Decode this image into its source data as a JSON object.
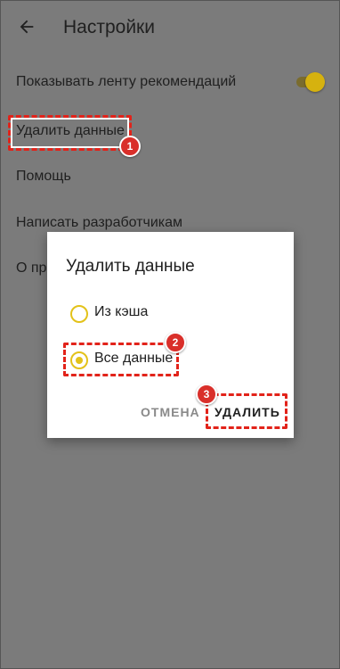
{
  "header": {
    "title": "Настройки",
    "back_icon": "arrow-back-icon"
  },
  "settings": {
    "items": [
      {
        "label": "Показывать ленту рекомендаций"
      },
      {
        "label": "Удалить данные"
      },
      {
        "label": "Помощь"
      },
      {
        "label": "Написать разработчикам"
      },
      {
        "label": "О про"
      }
    ],
    "toggle_on": true
  },
  "dialog": {
    "title": "Удалить данные",
    "options": [
      {
        "label": "Из кэша",
        "selected": false
      },
      {
        "label": "Все данные",
        "selected": true
      }
    ],
    "cancel_label": "ОТМЕНА",
    "confirm_label": "УДАЛИТЬ"
  },
  "annotations": {
    "step1": "1",
    "step2": "2",
    "step3": "3"
  },
  "colors": {
    "accent": "#e3c21a",
    "highlight": "#e2231a",
    "scrim": "#7b7b7b"
  }
}
